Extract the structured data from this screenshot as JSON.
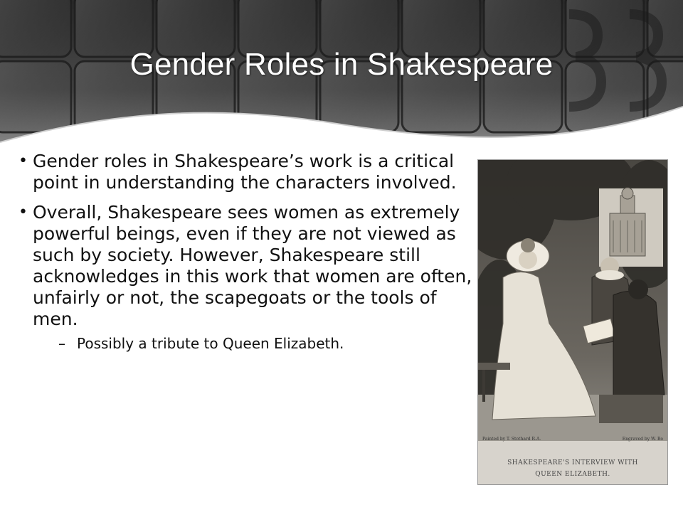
{
  "slide": {
    "title": "Gender Roles in Shakespeare",
    "bullets": [
      {
        "text": "Gender roles in Shakespeare’s work is a critical point in understanding the characters involved."
      },
      {
        "text": "Overall, Shakespeare sees women as extremely powerful beings, even if they are not viewed as such by society. However, Shakespeare still acknowledges in this work that women are often, unfairly or not, the scapegoats or the tools of men.",
        "sub_bullets": [
          "Possibly a tribute to Queen Elizabeth."
        ]
      }
    ],
    "bullet_glyph": "•",
    "sub_bullet_glyph": "–"
  },
  "picture": {
    "credit_left": "Painted by T. Stothard R.A.",
    "credit_right": "Engraved by W. Bo",
    "caption_line1": "SHAKESPEARE'S INTERVIEW WITH",
    "caption_line2": "QUEEN ELIZABETH."
  },
  "colors": {
    "header_dark": "#3a3a3a",
    "header_light": "#8a8a8a",
    "title_text": "#ffffff",
    "body_text": "#111111"
  }
}
